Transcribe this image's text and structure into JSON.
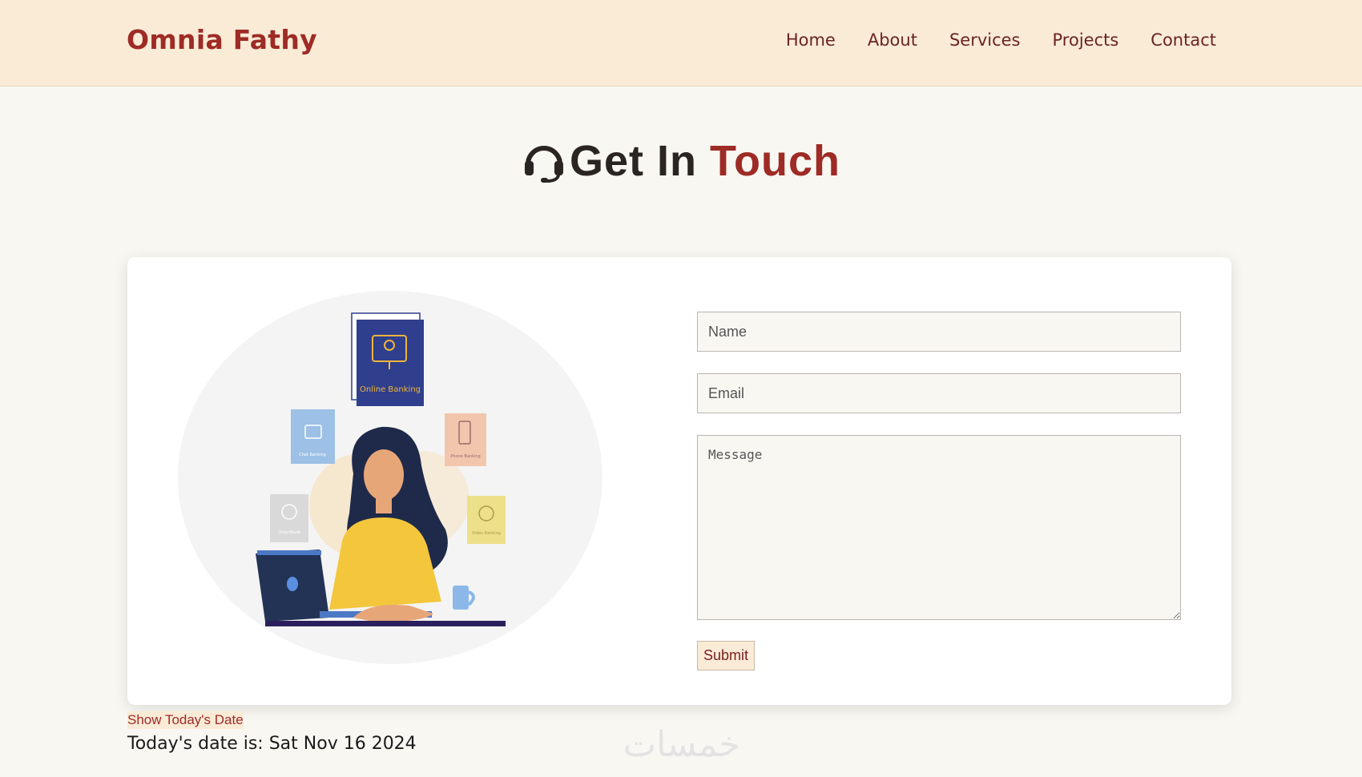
{
  "header": {
    "brand": "Omnia Fathy",
    "nav": [
      "Home",
      "About",
      "Services",
      "Projects",
      "Contact"
    ]
  },
  "title": {
    "part1": "Get In",
    "part2": "Touch",
    "icon": "headset-icon"
  },
  "illustration": {
    "labels": {
      "online": "Online Banking",
      "chat": "Chat Banking",
      "phone": "Phone Banking",
      "direct": "DirectBank",
      "video": "Video Banking"
    }
  },
  "form": {
    "name_placeholder": "Name",
    "email_placeholder": "Email",
    "message_placeholder": "Message",
    "submit_label": "Submit"
  },
  "date": {
    "button_label": "Show Today's Date",
    "text": "Today's date is: Sat Nov 16 2024"
  },
  "watermark": "خمسات",
  "colors": {
    "accent": "#9e2b25",
    "header_bg": "#faebd7",
    "page_bg": "#f8f7f2"
  }
}
